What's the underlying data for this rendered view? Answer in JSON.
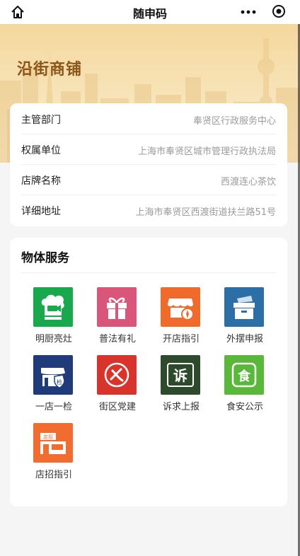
{
  "header": {
    "title": "随申码"
  },
  "hero": {
    "heading": "沿街商铺"
  },
  "info": [
    {
      "label": "主管部门",
      "value": "奉贤区行政服务中心"
    },
    {
      "label": "权属单位",
      "value": "上海市奉贤区城市管理行政执法局"
    },
    {
      "label": "店牌名称",
      "value": "西渡连心茶饮"
    },
    {
      "label": "详细地址",
      "value": "上海市奉贤区西渡街道扶兰路51号"
    }
  ],
  "services": {
    "title": "物体服务",
    "items": [
      {
        "label": "明厨亮灶",
        "icon": "chef-hat-camera-icon",
        "color": "#1aa84e"
      },
      {
        "label": "普法有礼",
        "icon": "gift-icon",
        "color": "#d9567a"
      },
      {
        "label": "开店指引",
        "icon": "storefront-compass-icon",
        "color": "#f06a2b"
      },
      {
        "label": "外摆申报",
        "icon": "box-icon",
        "color": "#2b6fa6"
      },
      {
        "label": "一店一检",
        "icon": "store-shield-icon",
        "color": "#1f3b7a"
      },
      {
        "label": "街区党建",
        "icon": "party-emblem-icon",
        "color": "#d9342b"
      },
      {
        "label": "诉求上报",
        "icon": "complaint-icon",
        "color": "#2e4a2c"
      },
      {
        "label": "食安公示",
        "icon": "food-safety-icon",
        "color": "#59b73a"
      },
      {
        "label": "店招指引",
        "icon": "sign-board-icon",
        "color": "#f26b2f"
      }
    ]
  }
}
